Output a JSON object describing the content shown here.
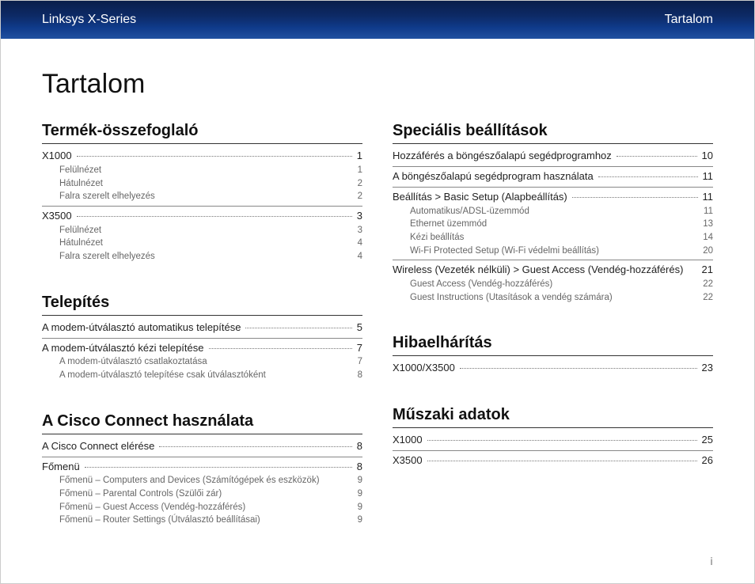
{
  "header": {
    "left": "Linksys X-Series",
    "right": "Tartalom"
  },
  "title": "Tartalom",
  "page_number": "i",
  "left_sections": [
    {
      "heading": "Termék-összefoglaló",
      "groups": [
        {
          "lead": {
            "label": "X1000",
            "page": "1",
            "dots": true
          },
          "subs": [
            {
              "label": "Felülnézet",
              "page": "1"
            },
            {
              "label": "Hátulnézet",
              "page": "2"
            },
            {
              "label": "Falra szerelt elhelyezés",
              "page": "2"
            }
          ]
        },
        {
          "lead": {
            "label": "X3500",
            "page": "3",
            "dots": true
          },
          "subs": [
            {
              "label": "Felülnézet",
              "page": "3"
            },
            {
              "label": "Hátulnézet",
              "page": "4"
            },
            {
              "label": "Falra szerelt elhelyezés",
              "page": "4"
            }
          ]
        }
      ]
    },
    {
      "heading": "Telepítés",
      "groups": [
        {
          "lead": {
            "label": "A modem-útválasztó automatikus telepítése",
            "page": "5",
            "dots": true
          },
          "subs": []
        },
        {
          "lead": {
            "label": "A modem-útválasztó kézi telepítése",
            "page": "7",
            "dots": true
          },
          "subs": [
            {
              "label": "A modem-útválasztó csatlakoztatása",
              "page": "7"
            },
            {
              "label": "A modem-útválasztó telepítése csak útválasztóként",
              "page": "8"
            }
          ]
        }
      ]
    },
    {
      "heading": "A Cisco Connect használata",
      "groups": [
        {
          "lead": {
            "label": "A Cisco Connect elérése",
            "page": "8",
            "dots": true
          },
          "subs": []
        },
        {
          "lead": {
            "label": "Főmenü",
            "page": "8",
            "dots": true
          },
          "subs": [
            {
              "label": "Főmenü – Computers and Devices (Számítógépek és eszközök)",
              "page": "9"
            },
            {
              "label": "Főmenü – Parental Controls (Szülői zár)",
              "page": "9"
            },
            {
              "label": "Főmenü – Guest Access (Vendég-hozzáférés)",
              "page": "9"
            },
            {
              "label": "Főmenü – Router Settings (Útválasztó beállításai)",
              "page": "9"
            }
          ]
        }
      ]
    }
  ],
  "right_sections": [
    {
      "heading": "Speciális beállítások",
      "groups": [
        {
          "lead": {
            "label": "Hozzáférés a böngészőalapú segédprogramhoz",
            "page": "10",
            "dots": true
          },
          "subs": []
        },
        {
          "lead": {
            "label": "A böngészőalapú segédprogram használata",
            "page": "11",
            "dots": true
          },
          "subs": []
        },
        {
          "lead": {
            "label": "Beállítás > Basic Setup (Alapbeállítás)",
            "page": "11",
            "dots": true
          },
          "subs": [
            {
              "label": "Automatikus/ADSL-üzemmód",
              "page": "11"
            },
            {
              "label": "Ethernet üzemmód",
              "page": "13"
            },
            {
              "label": "Kézi beállítás",
              "page": "14"
            },
            {
              "label": "Wi-Fi Protected Setup (Wi-Fi védelmi beállítás)",
              "page": "20"
            }
          ]
        },
        {
          "lead": {
            "label": "Wireless (Vezeték nélküli) > Guest Access (Vendég-hozzáférés)",
            "page": "21",
            "dots": false
          },
          "subs": [
            {
              "label": "Guest Access (Vendég-hozzáférés)",
              "page": "22"
            },
            {
              "label": "Guest Instructions (Utasítások a vendég számára)",
              "page": "22"
            }
          ]
        }
      ]
    },
    {
      "heading": "Hibaelhárítás",
      "groups": [
        {
          "lead": {
            "label": "X1000/X3500",
            "page": "23",
            "dots": true
          },
          "subs": []
        }
      ]
    },
    {
      "heading": "Műszaki adatok",
      "groups": [
        {
          "lead": {
            "label": "X1000",
            "page": "25",
            "dots": true
          },
          "subs": []
        },
        {
          "lead": {
            "label": "X3500",
            "page": "26",
            "dots": true
          },
          "subs": []
        }
      ]
    }
  ]
}
